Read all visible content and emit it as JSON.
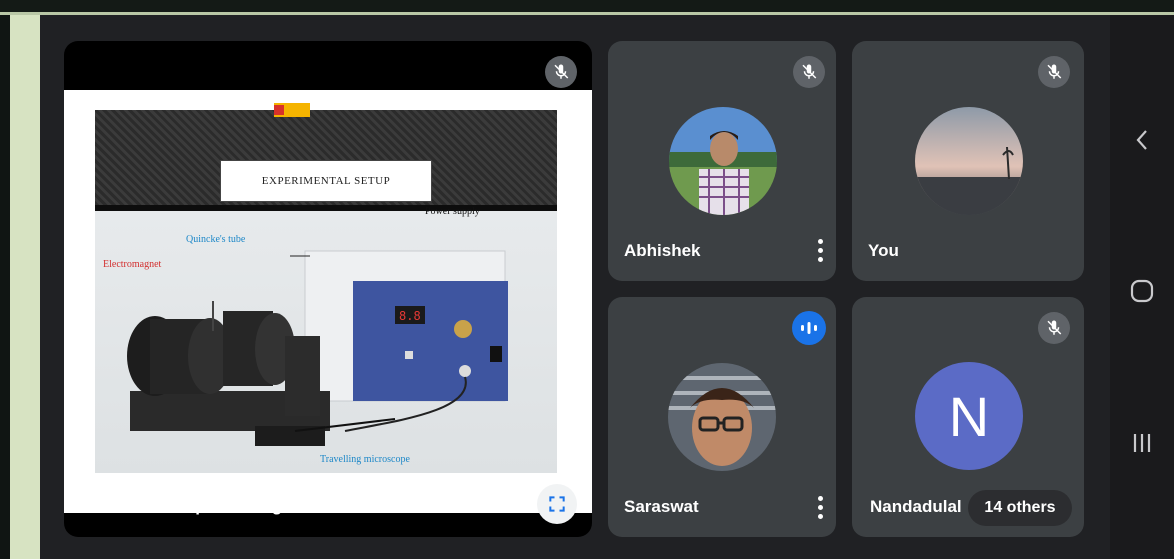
{
  "presentation": {
    "presenter_label": "Nandadulal is presenting",
    "slide": {
      "title": "EXPERIMENTAL SETUP",
      "labels": {
        "power_supply": "Power supply",
        "quinckes_tube": "Quincke's tube",
        "electromagnet": "Electromagnet",
        "travelling_microscope": "Travelling microscope"
      }
    }
  },
  "participants": [
    {
      "name": "Abhishek",
      "muted": true
    },
    {
      "name": "You",
      "muted": true
    },
    {
      "name": "Saraswat",
      "muted": false,
      "speaking": true
    },
    {
      "name": "Nandadulal",
      "muted": true,
      "avatar_letter": "N",
      "avatar_color": "#5b6bc6"
    }
  ],
  "others_label": "14 others",
  "colors": {
    "stage": "#202124",
    "tile": "#3c4043",
    "speaking_accent": "#1a73e8"
  },
  "system_nav": {
    "icons": [
      "back-icon",
      "home-icon",
      "recents-icon"
    ]
  }
}
